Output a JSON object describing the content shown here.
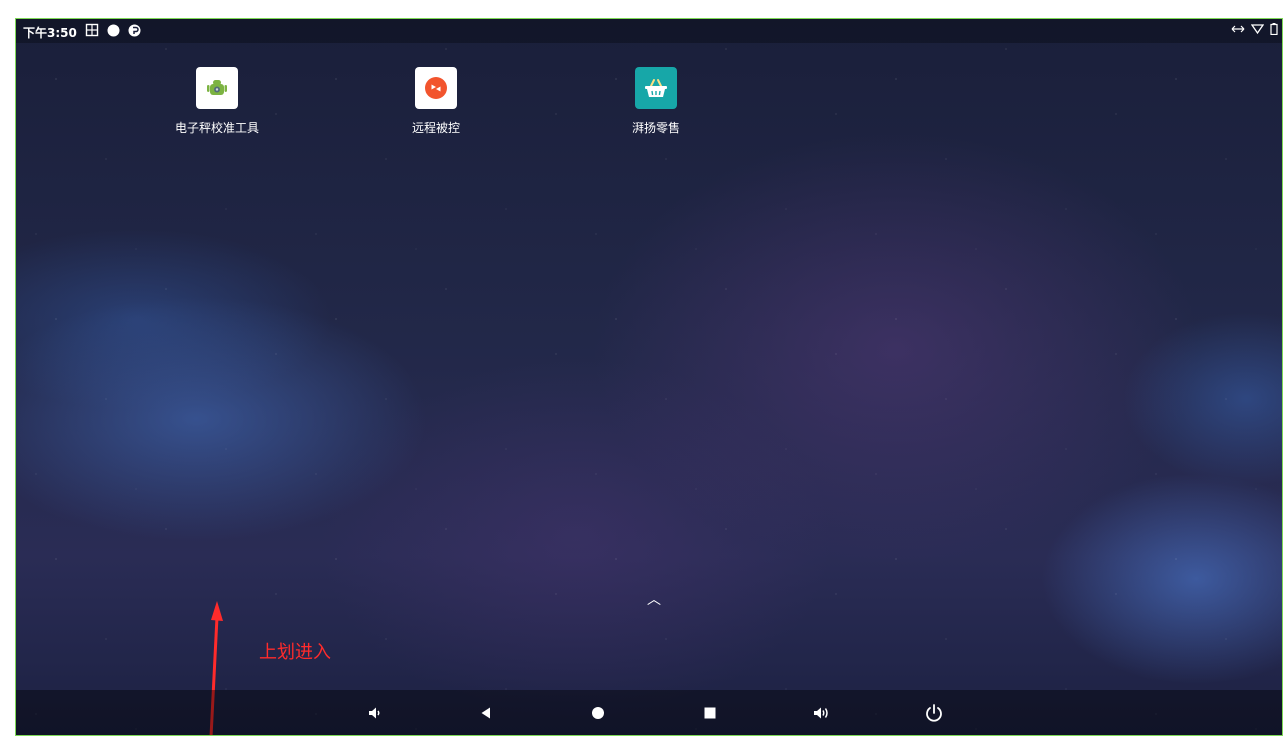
{
  "status_bar": {
    "time": "下午3:50",
    "notification_icons": [
      "screenshot-icon",
      "record-icon",
      "app-notification-icon"
    ],
    "system_icons": [
      "rotate-icon",
      "wifi-icon",
      "battery-icon"
    ]
  },
  "apps": [
    {
      "name": "电子秤校准工具",
      "icon": "android-app-icon"
    },
    {
      "name": "远程被控",
      "icon": "remote-control-icon"
    },
    {
      "name": "湃扬零售",
      "icon": "shopping-basket-icon"
    }
  ],
  "swipe_hint": "︿",
  "annotation": {
    "text": "上划进入",
    "color": "#ff2b2b"
  },
  "nav_bar": [
    "volume-down-icon",
    "back-icon",
    "home-icon",
    "recents-icon",
    "volume-up-icon",
    "power-icon"
  ],
  "colors": {
    "frame": "#7ed957",
    "retail_icon": "#17a7a8",
    "remote_icon": "#f2542d"
  }
}
